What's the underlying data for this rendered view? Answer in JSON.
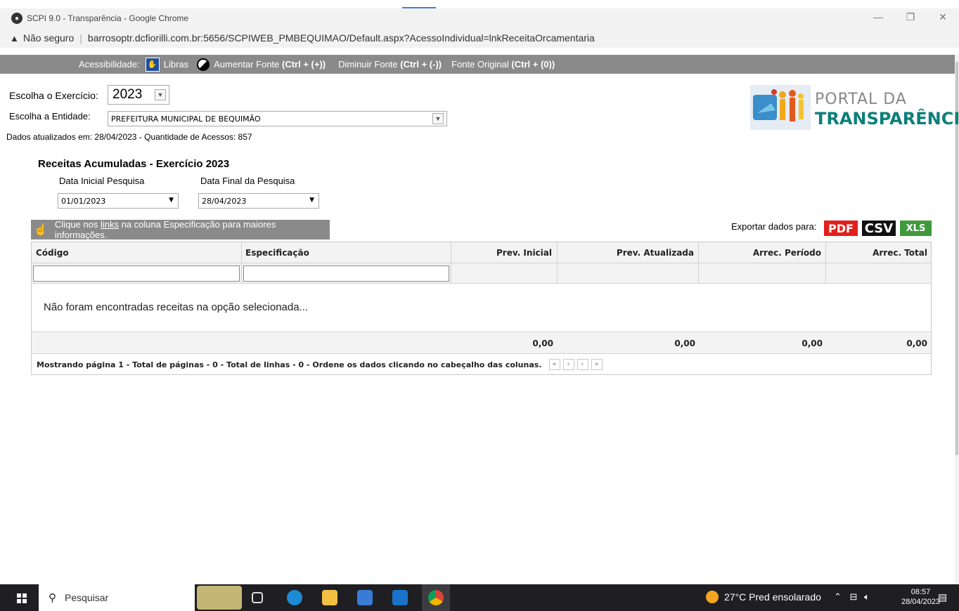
{
  "window": {
    "title": "SCPI 9.0 - Transparência - Google Chrome",
    "minimize": "—",
    "restore": "❐",
    "close": "✕"
  },
  "address": {
    "insecure_label": "Não seguro",
    "url": "barrosoptr.dcfiorilli.com.br:5656/SCPIWEB_PMBEQUIMAO/Default.aspx?AcessoIndividual=lnkReceitaOrcamentaria"
  },
  "accessibility": {
    "label": "Acessibilidade:",
    "libras": "Libras",
    "increase": "Aumentar Fonte",
    "increase_key": "(Ctrl + (+))",
    "decrease": "Diminuir Fonte",
    "decrease_key": "(Ctrl + (-))",
    "original": "Fonte Original",
    "original_key": "(Ctrl + (0))"
  },
  "filters": {
    "exercicio_label": "Escolha o Exercício:",
    "exercicio_value": "2023",
    "entidade_label": "Escolha a Entidade:",
    "entidade_value": "PREFEITURA MUNICIPAL DE BEQUIMÃO",
    "updated": "Dados atualizados em: 28/04/2023 - Quantidade de Acessos: 857"
  },
  "logo": {
    "line1": "PORTAL DA",
    "line2": "TRANSPARÊNCIA"
  },
  "section": {
    "title": "Receitas Acumuladas - Exercício 2023",
    "date_start_label": "Data Inicial Pesquisa",
    "date_end_label": "Data Final da Pesquisa",
    "date_start": "01/01/2023",
    "date_end": "28/04/2023"
  },
  "info": {
    "prefix": "Clique nos ",
    "link": "links",
    "suffix": " na coluna Especificação para maiores informações."
  },
  "export": {
    "label": "Exportar dados para:",
    "pdf": "PDF",
    "csv": "CSV",
    "xls": "XLS",
    "pdf_color": "#e3201b",
    "csv_color": "#111111",
    "xls_color": "#3f9a3c"
  },
  "table": {
    "columns": [
      "Código",
      "Especificação",
      "Prev. Inicial",
      "Prev. Atualizada",
      "Arrec. Período",
      "Arrec. Total"
    ],
    "empty_message": "Não foram encontradas receitas na opção selecionada...",
    "totals": [
      "0,00",
      "0,00",
      "0,00",
      "0,00"
    ],
    "pager_text": "Mostrando página 1 - Total de páginas - 0 - Total de linhas - 0 - Ordene os dados clicando no cabeçalho das colunas."
  },
  "taskbar": {
    "search_placeholder": "Pesquisar",
    "weather": "27°C  Pred ensolarado",
    "time": "08:57",
    "date": "28/04/2023"
  }
}
